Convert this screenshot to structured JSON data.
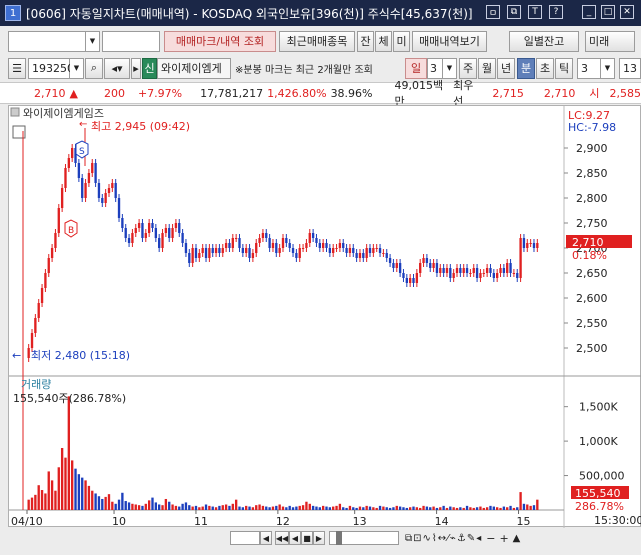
{
  "window": {
    "num": "1",
    "title": "[0606] 자동일지차트(매매내역) - KOSDAQ 외국인보유[396(천)] 주식수[45,637(천)]",
    "controls": [
      "ㅁ",
      "⧉",
      "T",
      "?",
      "_",
      "□",
      "✕"
    ]
  },
  "toolbar1": {
    "input1": "",
    "input2": "",
    "btn_trade_mark": "매매마크/내역 조회",
    "btn_recent": "최근매매종목",
    "btn_jan": "잔",
    "btn_che": "체",
    "btn_mi": "미",
    "btn_history": "매매내역보기",
    "btn_daily": "일별잔고",
    "btn_more": "미래"
  },
  "toolbar2": {
    "code": "193250",
    "tag": "신",
    "stock_name": "와이제이엠게",
    "note": "※분봉 마크는 최근 2개월만 조회",
    "periods": [
      "일",
      "3",
      "주",
      "월",
      "년",
      "분",
      "초",
      "틱"
    ],
    "interval": "3",
    "right_value": "13"
  },
  "quote": {
    "price": "2,710",
    "arrow": "▲",
    "change": "200",
    "change_pct": "+7.97%",
    "volume": "17,781,217",
    "vol_ratio": "1,426.80%",
    "turnover": "38.96%",
    "amount": "49,015백만",
    "bid_label": "최우선",
    "ask": "2,715",
    "bid": "2,710",
    "open_label": "시",
    "open": "2,585"
  },
  "chart": {
    "title": "와이제이엠게임즈",
    "high_label": "최고 2,945 (09:42)",
    "low_label": "최저 2,480 (15:18)",
    "lc": "LC:9.27",
    "hc": "HC:-7.98",
    "price_tag": "2,710",
    "pct_tag": "0.18%",
    "y_ticks": [
      "2,900",
      "2,850",
      "2,800",
      "2,750",
      "2,700",
      "2,650",
      "2,600",
      "2,550",
      "2,500"
    ],
    "y_values": [
      2900,
      2850,
      2800,
      2750,
      2700,
      2650,
      2600,
      2550,
      2500
    ],
    "volume_label": "거래량",
    "volume_value": "155,540주(286.78%)",
    "vol_ticks": [
      "1,500K",
      "1,000K",
      "500,000"
    ],
    "vol_tick_values": [
      1500000,
      1000000,
      500000
    ],
    "vol_tag": "155,540",
    "vol_pct_tag": "286.78%",
    "x_labels": [
      "04/10",
      "10",
      "11",
      "12",
      "13",
      "14",
      "15"
    ],
    "time_label": "15:30:00",
    "marker_s": "S",
    "marker_b": "B"
  },
  "chart_data": {
    "type": "candlestick",
    "price_range": [
      2460,
      2960
    ],
    "volume_range": [
      0,
      1800000
    ],
    "closes": [
      2500,
      2530,
      2560,
      2590,
      2620,
      2650,
      2680,
      2700,
      2730,
      2780,
      2820,
      2860,
      2880,
      2900,
      2870,
      2840,
      2800,
      2830,
      2850,
      2870,
      2830,
      2800,
      2790,
      2810,
      2820,
      2830,
      2800,
      2760,
      2740,
      2720,
      2710,
      2730,
      2740,
      2750,
      2720,
      2730,
      2750,
      2740,
      2720,
      2700,
      2730,
      2740,
      2720,
      2740,
      2750,
      2730,
      2710,
      2690,
      2670,
      2700,
      2680,
      2690,
      2700,
      2680,
      2700,
      2690,
      2700,
      2690,
      2700,
      2710,
      2700,
      2720,
      2720,
      2700,
      2690,
      2700,
      2680,
      2690,
      2710,
      2720,
      2730,
      2720,
      2700,
      2710,
      2690,
      2700,
      2720,
      2710,
      2700,
      2690,
      2680,
      2700,
      2700,
      2710,
      2730,
      2720,
      2710,
      2700,
      2710,
      2700,
      2690,
      2700,
      2700,
      2710,
      2700,
      2690,
      2700,
      2690,
      2680,
      2690,
      2680,
      2700,
      2690,
      2700,
      2700,
      2690,
      2690,
      2680,
      2670,
      2660,
      2670,
      2650,
      2640,
      2630,
      2640,
      2630,
      2650,
      2670,
      2680,
      2670,
      2660,
      2670,
      2650,
      2660,
      2650,
      2660,
      2640,
      2650,
      2660,
      2650,
      2660,
      2650,
      2650,
      2660,
      2640,
      2650,
      2650,
      2660,
      2650,
      2640,
      2650,
      2660,
      2650,
      2670,
      2650,
      2650,
      2640,
      2720,
      2700,
      2710,
      2710,
      2700,
      2710
    ],
    "volumes": [
      150000,
      180000,
      220000,
      360000,
      290000,
      240000,
      560000,
      430000,
      280000,
      620000,
      900000,
      760000,
      1650000,
      720000,
      600000,
      520000,
      470000,
      430000,
      350000,
      280000,
      240000,
      200000,
      160000,
      190000,
      230000,
      120000,
      90000,
      150000,
      250000,
      130000,
      110000,
      90000,
      80000,
      70000,
      60000,
      90000,
      140000,
      180000,
      110000,
      80000,
      70000,
      160000,
      120000,
      80000,
      60000,
      50000,
      90000,
      110000,
      70000,
      50000,
      60000,
      40000,
      50000,
      80000,
      60000,
      50000,
      40000,
      60000,
      70000,
      80000,
      60000,
      90000,
      150000,
      50000,
      40000,
      60000,
      50000,
      40000,
      70000,
      80000,
      60000,
      50000,
      40000,
      50000,
      60000,
      80000,
      50000,
      40000,
      60000,
      40000,
      50000,
      60000,
      70000,
      120000,
      90000,
      60000,
      50000,
      40000,
      60000,
      50000,
      40000,
      50000,
      60000,
      90000,
      40000,
      30000,
      60000,
      40000,
      30000,
      50000,
      40000,
      60000,
      50000,
      40000,
      30000,
      60000,
      50000,
      40000,
      30000,
      40000,
      60000,
      50000,
      40000,
      30000,
      40000,
      50000,
      40000,
      30000,
      60000,
      50000,
      40000,
      50000,
      30000,
      40000,
      60000,
      30000,
      50000,
      40000,
      30000,
      40000,
      30000,
      60000,
      40000,
      30000,
      40000,
      50000,
      30000,
      40000,
      60000,
      50000,
      40000,
      30000,
      50000,
      40000,
      60000,
      30000,
      40000,
      260000,
      90000,
      80000,
      60000,
      70000,
      150000
    ]
  }
}
